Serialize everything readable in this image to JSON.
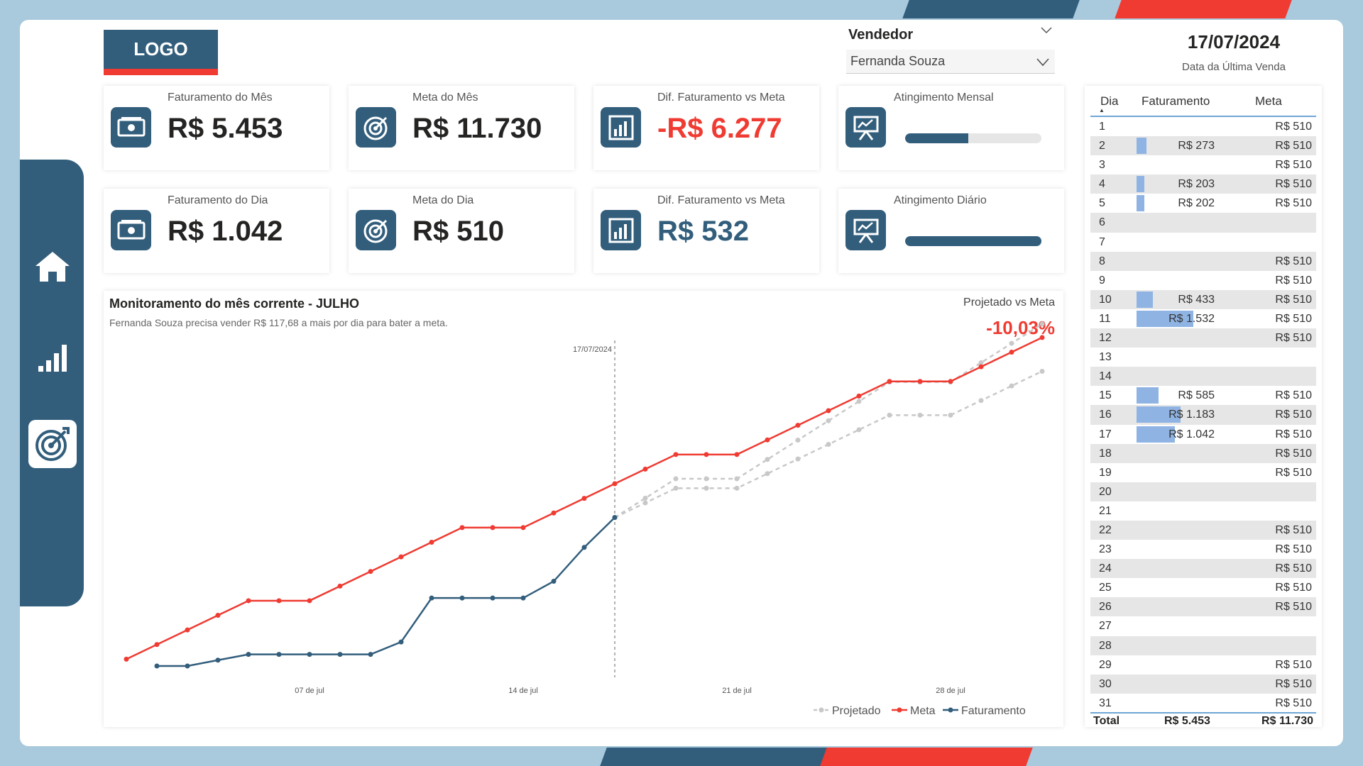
{
  "logo": "LOGO",
  "slicer": {
    "title": "Vendedor",
    "value": "Fernanda Souza"
  },
  "last_sale": {
    "date": "17/07/2024",
    "caption": "Data da Última Venda"
  },
  "cards": {
    "fat_mes": {
      "caption": "Faturamento do Mês",
      "value": "R$ 5.453"
    },
    "meta_mes": {
      "caption": "Meta do Mês",
      "value": "R$ 11.730"
    },
    "dif_mes": {
      "caption": "Dif. Faturamento vs Meta",
      "value": "-R$ 6.277",
      "color": "#ef3b32"
    },
    "ating_mes": {
      "caption": "Atingimento Mensal",
      "fraction": 0.465
    },
    "fat_dia": {
      "caption": "Faturamento do Dia",
      "value": "R$ 1.042"
    },
    "meta_dia": {
      "caption": "Meta do Dia",
      "value": "R$ 510"
    },
    "dif_dia": {
      "caption": "Dif. Faturamento vs Meta",
      "value": "R$ 532",
      "color": "#325e7c"
    },
    "ating_dia": {
      "caption": "Atingimento Diário",
      "fraction": 1.0
    }
  },
  "chart": {
    "title": "Monitoramento do mês corrente - JULHO",
    "subtitle": "Fernanda Souza precisa vender R$ 117,68 a mais por dia para bater a meta.",
    "proj_caption": "Projetado vs Meta",
    "proj_value": "-10,03%",
    "ref_label": "17/07/2024"
  },
  "chart_data": {
    "type": "line",
    "x_start_day": 1,
    "x_ticks": [
      {
        "day": 7,
        "label": "07 de jul"
      },
      {
        "day": 14,
        "label": "14 de jul"
      },
      {
        "day": 21,
        "label": "21 de jul"
      },
      {
        "day": 28,
        "label": "28 de jul"
      }
    ],
    "ref_day": 17,
    "ylim": [
      0,
      12000
    ],
    "legend": [
      "Projetado",
      "Meta",
      "Faturamento"
    ],
    "series": [
      {
        "name": "Meta",
        "color": "#ef3b32",
        "dashed": false,
        "x": [
          1,
          2,
          3,
          4,
          5,
          6,
          7,
          8,
          9,
          10,
          11,
          12,
          13,
          14,
          15,
          16,
          17,
          18,
          19,
          20,
          21,
          22,
          23,
          24,
          25,
          26,
          27,
          28,
          29,
          30,
          31
        ],
        "values": [
          510,
          1020,
          1530,
          2040,
          2550,
          2550,
          2550,
          3060,
          3570,
          4080,
          4590,
          5100,
          5100,
          5100,
          5610,
          6120,
          6630,
          7140,
          7650,
          7650,
          7650,
          8160,
          8670,
          9180,
          9690,
          10200,
          10200,
          10200,
          10710,
          11220,
          11730
        ]
      },
      {
        "name": "Faturamento",
        "color": "#325e7c",
        "dashed": false,
        "x": [
          2,
          3,
          4,
          5,
          6,
          7,
          8,
          9,
          10,
          11,
          12,
          13,
          14,
          15,
          16,
          17
        ],
        "values": [
          273,
          273,
          476,
          678,
          678,
          678,
          678,
          678,
          1111,
          2643,
          2643,
          2643,
          2643,
          3228,
          4411,
          5453
        ]
      },
      {
        "name": "Projetado",
        "color": "#c8c8c8",
        "dashed": true,
        "x": [
          17,
          18,
          19,
          20,
          21,
          22,
          23,
          24,
          25,
          26,
          27,
          28,
          29,
          30,
          31
        ],
        "values": [
          5453,
          5963,
          6473,
          6473,
          6473,
          6983,
          7493,
          8003,
          8513,
          9023,
          9023,
          9023,
          9533,
          10043,
          10553
        ]
      },
      {
        "name": "",
        "color": "#c8c8c8",
        "dashed": true,
        "x": [
          17,
          18,
          19,
          20,
          21,
          22,
          23,
          24,
          25,
          26,
          27,
          28,
          29,
          30,
          31
        ],
        "values": [
          5453,
          6128,
          6803,
          6803,
          6803,
          7478,
          8153,
          8828,
          9503,
          10178,
          10178,
          10178,
          10853,
          11528,
          12203
        ]
      }
    ]
  },
  "table": {
    "headers": {
      "dia": "Dia",
      "fat": "Faturamento",
      "meta": "Meta"
    },
    "fat_max": 1532,
    "rows": [
      {
        "dia": "1",
        "fat": "",
        "fv": 0,
        "meta": "R$ 510"
      },
      {
        "dia": "2",
        "fat": "R$ 273",
        "fv": 273,
        "meta": "R$ 510"
      },
      {
        "dia": "3",
        "fat": "",
        "fv": 0,
        "meta": "R$ 510"
      },
      {
        "dia": "4",
        "fat": "R$ 203",
        "fv": 203,
        "meta": "R$ 510"
      },
      {
        "dia": "5",
        "fat": "R$ 202",
        "fv": 202,
        "meta": "R$ 510"
      },
      {
        "dia": "6",
        "fat": "",
        "fv": 0,
        "meta": ""
      },
      {
        "dia": "7",
        "fat": "",
        "fv": 0,
        "meta": ""
      },
      {
        "dia": "8",
        "fat": "",
        "fv": 0,
        "meta": "R$ 510"
      },
      {
        "dia": "9",
        "fat": "",
        "fv": 0,
        "meta": "R$ 510"
      },
      {
        "dia": "10",
        "fat": "R$ 433",
        "fv": 433,
        "meta": "R$ 510"
      },
      {
        "dia": "11",
        "fat": "R$ 1.532",
        "fv": 1532,
        "meta": "R$ 510"
      },
      {
        "dia": "12",
        "fat": "",
        "fv": 0,
        "meta": "R$ 510"
      },
      {
        "dia": "13",
        "fat": "",
        "fv": 0,
        "meta": ""
      },
      {
        "dia": "14",
        "fat": "",
        "fv": 0,
        "meta": ""
      },
      {
        "dia": "15",
        "fat": "R$ 585",
        "fv": 585,
        "meta": "R$ 510"
      },
      {
        "dia": "16",
        "fat": "R$ 1.183",
        "fv": 1183,
        "meta": "R$ 510"
      },
      {
        "dia": "17",
        "fat": "R$ 1.042",
        "fv": 1042,
        "meta": "R$ 510"
      },
      {
        "dia": "18",
        "fat": "",
        "fv": 0,
        "meta": "R$ 510"
      },
      {
        "dia": "19",
        "fat": "",
        "fv": 0,
        "meta": "R$ 510"
      },
      {
        "dia": "20",
        "fat": "",
        "fv": 0,
        "meta": ""
      },
      {
        "dia": "21",
        "fat": "",
        "fv": 0,
        "meta": ""
      },
      {
        "dia": "22",
        "fat": "",
        "fv": 0,
        "meta": "R$ 510"
      },
      {
        "dia": "23",
        "fat": "",
        "fv": 0,
        "meta": "R$ 510"
      },
      {
        "dia": "24",
        "fat": "",
        "fv": 0,
        "meta": "R$ 510"
      },
      {
        "dia": "25",
        "fat": "",
        "fv": 0,
        "meta": "R$ 510"
      },
      {
        "dia": "26",
        "fat": "",
        "fv": 0,
        "meta": "R$ 510"
      },
      {
        "dia": "27",
        "fat": "",
        "fv": 0,
        "meta": ""
      },
      {
        "dia": "28",
        "fat": "",
        "fv": 0,
        "meta": ""
      },
      {
        "dia": "29",
        "fat": "",
        "fv": 0,
        "meta": "R$ 510"
      },
      {
        "dia": "30",
        "fat": "",
        "fv": 0,
        "meta": "R$ 510"
      },
      {
        "dia": "31",
        "fat": "",
        "fv": 0,
        "meta": "R$ 510"
      }
    ],
    "total": {
      "label": "Total",
      "fat": "R$ 5.453",
      "meta": "R$ 11.730"
    }
  },
  "nav": [
    "home-icon",
    "bar-chart-icon",
    "target-icon"
  ],
  "colors": {
    "primary": "#325e7c",
    "accent": "#ef3b32",
    "background": "#a9c9dd"
  }
}
